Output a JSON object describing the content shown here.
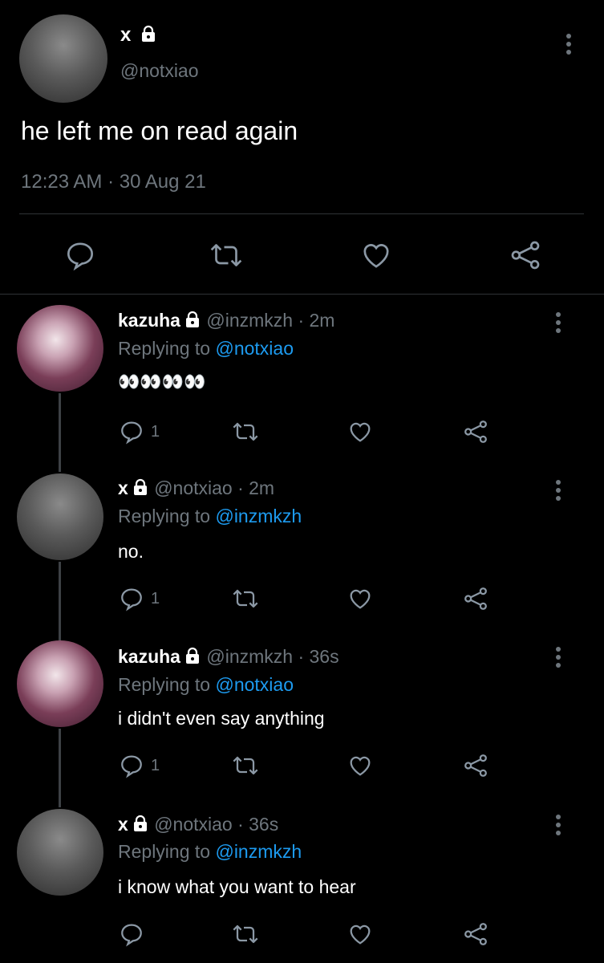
{
  "main_tweet": {
    "name": "x",
    "handle": "@notxiao",
    "text": "he left me on read again",
    "timestamp": "12:23 AM · 30 Aug 21"
  },
  "replies": [
    {
      "name": "kazuha",
      "meta": "@inzmkzh · 2m",
      "replying_prefix": "Replying to",
      "replying_to": "@notxiao",
      "text": "👀👀👀👀",
      "reply_count": "1"
    },
    {
      "name": "x",
      "meta": "@notxiao · 2m",
      "replying_prefix": "Replying to",
      "replying_to": "@inzmkzh",
      "text": "no.",
      "reply_count": "1"
    },
    {
      "name": "kazuha",
      "meta": "@inzmkzh · 36s",
      "replying_prefix": "Replying to",
      "replying_to": "@notxiao",
      "text": "i didn't even say anything",
      "reply_count": "1"
    },
    {
      "name": "x",
      "meta": "@notxiao · 36s",
      "replying_prefix": "Replying to",
      "replying_to": "@inzmkzh",
      "text": "i know what you want to hear",
      "reply_count": ""
    }
  ],
  "colors": {
    "background": "#000000",
    "text": "#ffffff",
    "muted": "#6e767d",
    "link": "#1d9bf0"
  }
}
